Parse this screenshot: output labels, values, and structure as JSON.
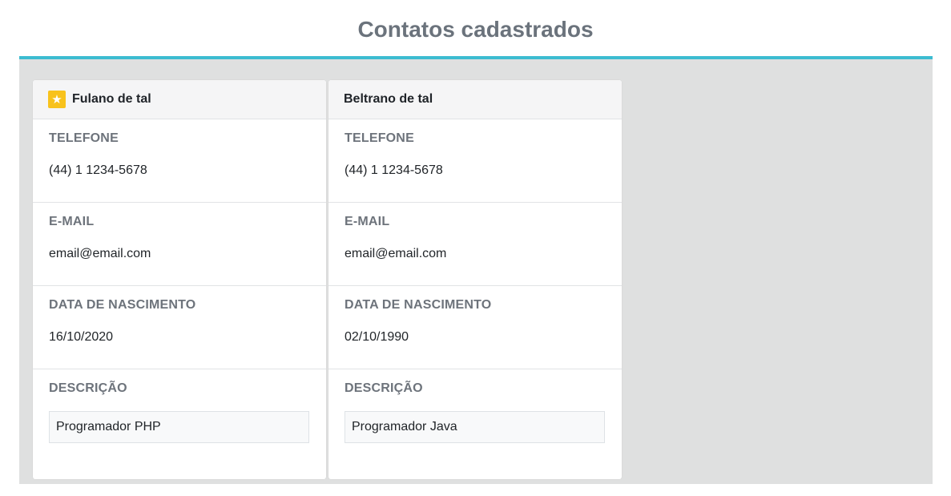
{
  "page": {
    "title": "Contatos cadastrados"
  },
  "colors": {
    "accent": "#3cbcd1",
    "star": "#f8c21c",
    "panel_bg": "#dfe0e0"
  },
  "labels": {
    "phone": "TELEFONE",
    "email": "E-MAIL",
    "birth": "DATA DE NASCIMENTO",
    "description": "DESCRIÇÃO"
  },
  "contacts": [
    {
      "name": "Fulano de tal",
      "favorite": true,
      "favorite_icon": "★",
      "phone": "(44) 1 1234-5678",
      "email": "email@email.com",
      "birth": "16/10/2020",
      "description": "Programador PHP"
    },
    {
      "name": "Beltrano de tal",
      "favorite": false,
      "phone": "(44) 1 1234-5678",
      "email": "email@email.com",
      "birth": "02/10/1990",
      "description": "Programador Java"
    }
  ]
}
